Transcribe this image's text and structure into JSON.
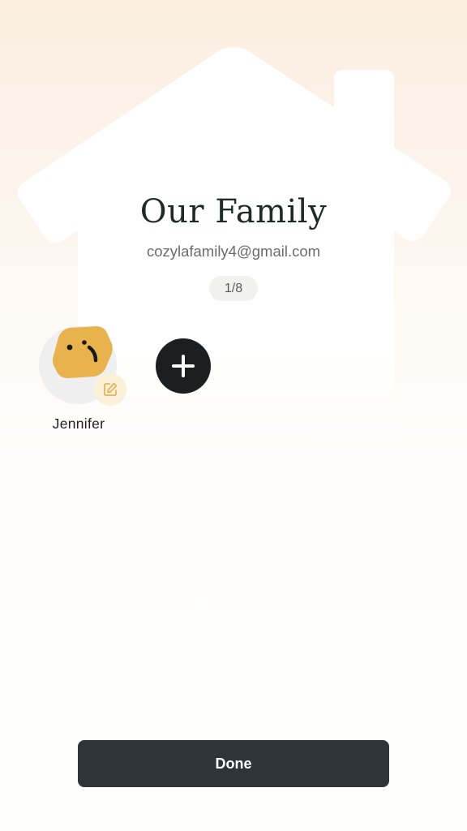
{
  "family": {
    "title": "Our Family",
    "email": "cozylafamily4@gmail.com",
    "member_count": "1/8"
  },
  "members": [
    {
      "name": "Jennifer",
      "avatar_icon": "face-avatar-icon",
      "avatar_color": "#e8b24c"
    }
  ],
  "actions": {
    "add_member_icon": "plus-icon",
    "edit_icon": "edit-icon",
    "done_label": "Done"
  },
  "colors": {
    "accent_dark": "#2f3439",
    "avatar_yellow": "#e8b24c",
    "edit_badge_bg": "#fbf0d8",
    "edit_icon": "#e4b45a"
  }
}
